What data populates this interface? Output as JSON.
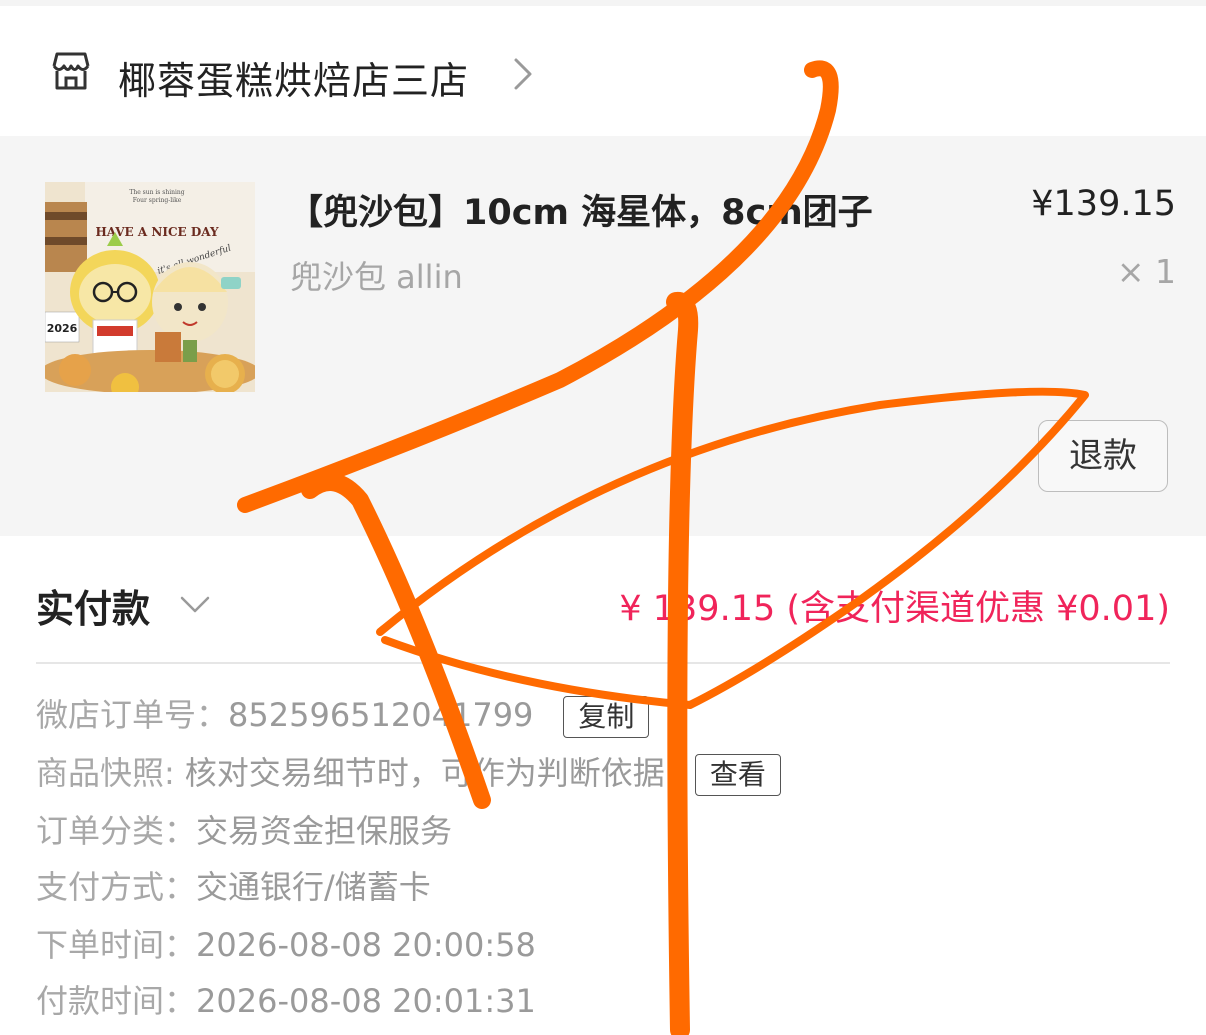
{
  "shop": {
    "name": "椰蓉蛋糕烘焙店三店"
  },
  "product": {
    "title": "【兜沙包】10cm 海星体，8cm团子",
    "variant": "兜沙包 allin",
    "price": "¥139.15",
    "quantity": "× 1",
    "refund_label": "退款",
    "thumbnail_text": {
      "line1": "The sun is shining",
      "line2": "Four spring-like",
      "headline": "HAVE A NICE DAY",
      "script": "it's all wonderful",
      "year": "2026"
    }
  },
  "payment": {
    "label": "实付款",
    "amount_text": "¥ 139.15 (含支付渠道优惠 ¥0.01)"
  },
  "details": {
    "order_no_label": "微店订单号：",
    "order_no": "852596512041799",
    "copy_label": "复制",
    "snapshot_label": "商品快照:",
    "snapshot_text": "核对交易细节时，可作为判断依据",
    "view_label": "查看",
    "category_label": "订单分类：",
    "category": "交易资金担保服务",
    "pay_method_label": "支付方式：",
    "pay_method": "交通银行/储蓄卡",
    "order_time_label": "下单时间：",
    "order_time": "2026-08-08 20:00:58",
    "pay_time_label": "付款时间：",
    "pay_time": "2026-08-08 20:01:31"
  },
  "colors": {
    "price_red": "#f0245a",
    "scribble_orange": "#ff6a00",
    "product_bg": "#f5f5f5"
  },
  "icons": {
    "shop": "storefront-icon",
    "forward": "chevron-right-icon",
    "expand": "chevron-down-icon"
  }
}
